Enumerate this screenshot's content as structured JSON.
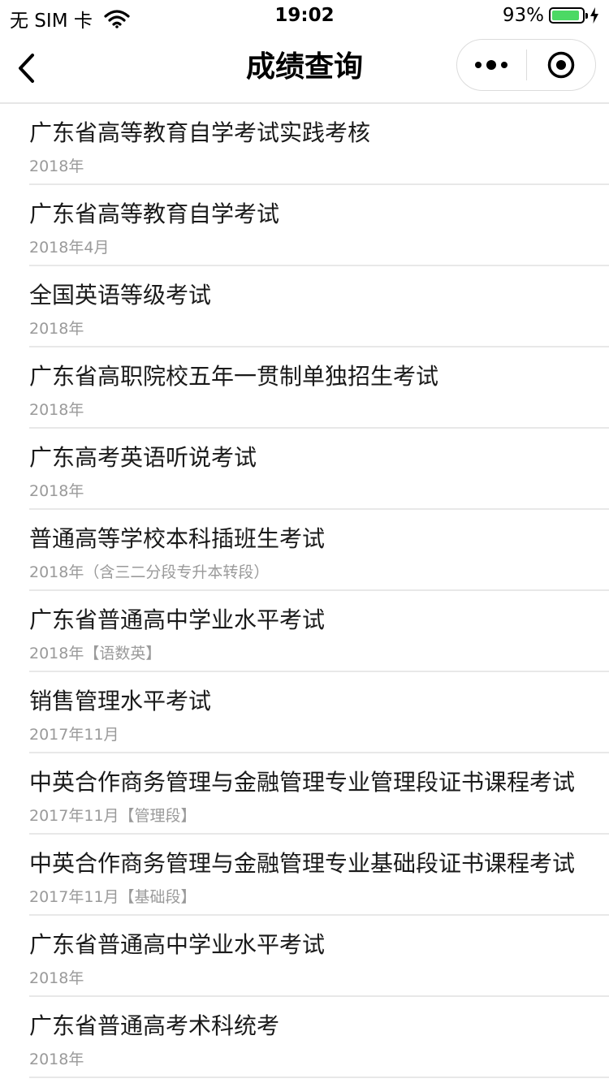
{
  "status_bar": {
    "carrier": "无 SIM 卡",
    "time": "19:02",
    "battery_percent": "93%",
    "battery_level": 0.93,
    "icons": [
      "wifi-icon",
      "battery-icon",
      "charging-icon"
    ]
  },
  "nav": {
    "title": "成绩查询",
    "back_icon": "chevron-left-icon",
    "menu_icon": "more-dots-icon",
    "close_icon": "target-circle-icon"
  },
  "exams": [
    {
      "title": "广东省高等教育自学考试实践考核",
      "sub": "2018年"
    },
    {
      "title": "广东省高等教育自学考试",
      "sub": "2018年4月"
    },
    {
      "title": "全国英语等级考试",
      "sub": "2018年"
    },
    {
      "title": "广东省高职院校五年一贯制单独招生考试",
      "sub": "2018年"
    },
    {
      "title": "广东高考英语听说考试",
      "sub": "2018年"
    },
    {
      "title": "普通高等学校本科插班生考试",
      "sub": "2018年（含三二分段专升本转段）"
    },
    {
      "title": "广东省普通高中学业水平考试",
      "sub": "2018年【语数英】"
    },
    {
      "title": "销售管理水平考试",
      "sub": "2017年11月"
    },
    {
      "title": "中英合作商务管理与金融管理专业管理段证书课程考试",
      "sub": "2017年11月【管理段】"
    },
    {
      "title": "中英合作商务管理与金融管理专业基础段证书课程考试",
      "sub": "2017年11月【基础段】"
    },
    {
      "title": "广东省普通高中学业水平考试",
      "sub": "2018年"
    },
    {
      "title": "广东省普通高考术科统考",
      "sub": "2018年"
    }
  ]
}
